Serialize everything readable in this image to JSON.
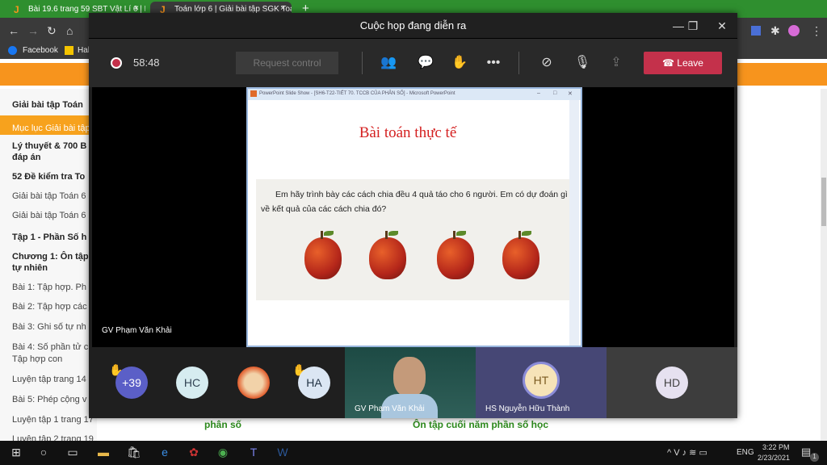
{
  "browser": {
    "tabs": [
      {
        "label": "Bài 19.6 trang 59 SBT Vật Lí 6 | H",
        "favicon": "J"
      },
      {
        "label": "Toán lớp 6 | Giải bài tập SGK Toán",
        "favicon": "J"
      }
    ],
    "new_tab": "+",
    "bookmarks": [
      {
        "label": "Facebook"
      },
      {
        "label": "Hal"
      }
    ]
  },
  "sidebar": {
    "items": [
      {
        "label": "Giải bài tập Toán",
        "bold": true
      },
      {
        "label": "Mục lục Giải bài tập",
        "active": true
      },
      {
        "label": "Lý thuyết & 700 B",
        "bold": true
      },
      {
        "label": "đáp án",
        "bold": true
      },
      {
        "label": "52 Đề kiểm tra To",
        "bold": true
      },
      {
        "label": "Giải bài tập Toán 6"
      },
      {
        "label": "Giải bài tập Toán 6"
      },
      {
        "label": "Tập 1 - Phần Số h",
        "bold": true
      },
      {
        "label": "Chương 1: Ôn tập",
        "bold": true
      },
      {
        "label": "tự nhiên",
        "bold": true
      },
      {
        "label": "Bài 1: Tập hợp. Ph"
      },
      {
        "label": "Bài 2: Tập hợp các"
      },
      {
        "label": "Bài 3: Ghi số tự nh"
      },
      {
        "label": "Bài 4: Số phần tử c"
      },
      {
        "label": "Tập hợp con"
      },
      {
        "label": "Luyện tập trang 14"
      },
      {
        "label": "Bài 5: Phép cộng v"
      },
      {
        "label": "Luyện tập 1 trang 17"
      },
      {
        "label": "Luyện tập 2 trang 19"
      }
    ]
  },
  "page": {
    "link1": "phân số",
    "link2": "Ôn tập cuối năm phần số học"
  },
  "meeting": {
    "title": "Cuộc họp đang diễn ra",
    "timer": "58:48",
    "request_control": "Request control",
    "leave": "Leave",
    "presenter": "GV Phạm Văn Khải",
    "slide": {
      "window_title": "PowerPoint Slide Show - [SH6-T22-TIẾT 70. TCCB CỦA PHÂN SỐ] - Microsoft PowerPoint",
      "heading": "Bài toán thực tế",
      "body": "Em hãy trình bày các cách chia đều 4 quả táo cho 6 người. Em có dự đoán gì về kết quả của các cách chia đó?"
    },
    "participants": {
      "overflow": "+39",
      "hc": "HC",
      "ha": "HA",
      "video_name": "GV Phạm Văn Khải",
      "ht": "HT",
      "ht_name": "HS Nguyễn Hữu Thành",
      "hd": "HD"
    }
  },
  "taskbar": {
    "lang": "ENG",
    "time": "3:22 PM",
    "date": "2/23/2021",
    "notifications": "1"
  }
}
